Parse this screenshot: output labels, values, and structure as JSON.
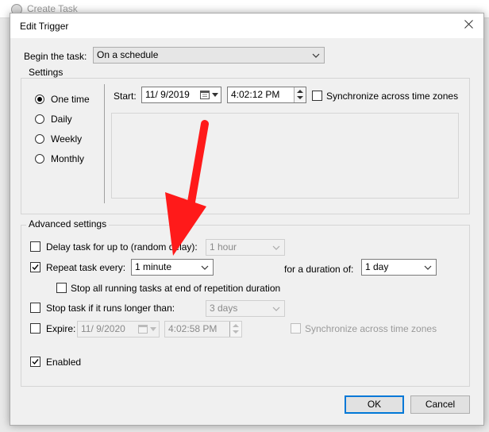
{
  "background_window": {
    "title": "Create Task"
  },
  "dialog": {
    "title": "Edit Trigger",
    "begin_label": "Begin the task:",
    "begin_value": "On a schedule",
    "settings": {
      "group_label": "Settings",
      "radios": [
        "One time",
        "Daily",
        "Weekly",
        "Monthly"
      ],
      "selected": "One time",
      "start_label": "Start:",
      "start_date": "11/ 9/2019",
      "start_time": "4:02:12 PM",
      "sync_label": "Synchronize across time zones"
    },
    "advanced": {
      "group_label": "Advanced settings",
      "delay_label": "Delay task for up to (random delay):",
      "delay_value": "1 hour",
      "repeat_label": "Repeat task every:",
      "repeat_value": "1 minute",
      "duration_label": "for a duration of:",
      "duration_value": "1 day",
      "stop_all_label": "Stop all running tasks at end of repetition duration",
      "stop_longer_label": "Stop task if it runs longer than:",
      "stop_longer_value": "3 days",
      "expire_label": "Expire:",
      "expire_date": "11/ 9/2020",
      "expire_time": "4:02:58 PM",
      "expire_sync_label": "Synchronize across time zones",
      "enabled_label": "Enabled"
    },
    "buttons": {
      "ok": "OK",
      "cancel": "Cancel"
    }
  },
  "checkbox_states": {
    "sync": false,
    "delay": false,
    "repeat": true,
    "stop_all": false,
    "stop_longer": false,
    "expire": false,
    "expire_sync": false,
    "enabled": true
  },
  "annotation": {
    "arrow_color": "#ff1a1a"
  }
}
